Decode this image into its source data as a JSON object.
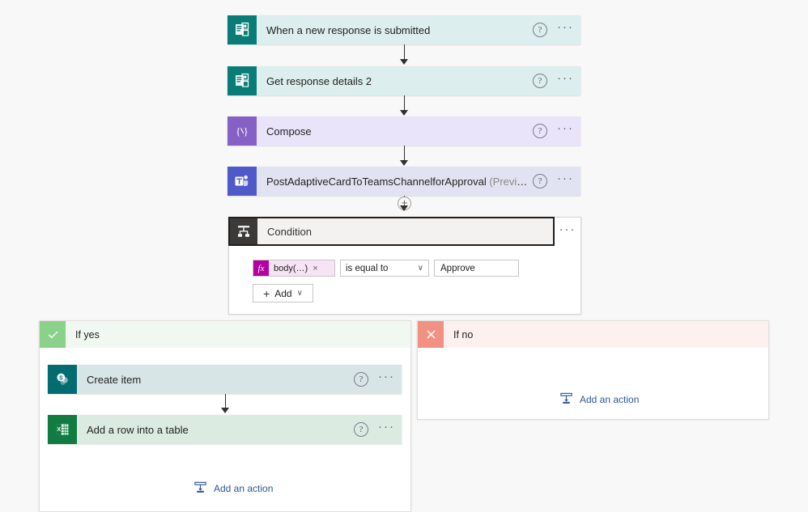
{
  "app": {
    "title": "Power Automate flow designer canvas",
    "canvas_bg": "#f8f8f8"
  },
  "flow": {
    "steps": [
      {
        "id": "trigger-forms",
        "title": "When a new response is submitted",
        "preview": "",
        "icon": "microsoft-forms-icon",
        "icon_bg": "#0a7c77",
        "card_bg": "#dceeee",
        "help_label": "?",
        "menu_label": "···"
      },
      {
        "id": "get-response-details",
        "title": "Get response details 2",
        "preview": "",
        "icon": "microsoft-forms-icon",
        "icon_bg": "#0a7c77",
        "card_bg": "#dceeee",
        "help_label": "?",
        "menu_label": "···"
      },
      {
        "id": "compose",
        "title": "Compose",
        "preview": "",
        "icon": "compose-braces-icon",
        "icon_bg": "#8661c5",
        "card_bg": "#eae4fb",
        "help_label": "?",
        "menu_label": "···"
      },
      {
        "id": "post-adaptive-card-teams",
        "title": "PostAdaptiveCardToTeamsChannelforApproval",
        "preview": "(Preview)",
        "icon": "microsoft-teams-icon",
        "icon_bg": "#5059c9",
        "card_bg": "#e2e3f2",
        "help_label": "?",
        "menu_label": "···"
      }
    ],
    "insert_node_label": "+"
  },
  "condition": {
    "title": "Condition",
    "icon": "condition-branch-icon",
    "menu_label": "···",
    "row": {
      "fx_label": "fx",
      "token_text": "body(…)",
      "token_remove": "×",
      "operator": "is equal to",
      "operator_chevron": "∨",
      "value": "Approve"
    },
    "add_button": {
      "plus": "+",
      "label": "Add",
      "chevron": "∨"
    }
  },
  "branches": {
    "yes": {
      "label": "If yes",
      "flag_icon": "checkmark-icon",
      "flag_color": "#8ad18a",
      "actions": [
        {
          "id": "create-item",
          "title": "Create item",
          "icon": "sharepoint-icon",
          "icon_bg": "#036c70",
          "card_bg": "#d8e5e6",
          "help_label": "?",
          "menu_label": "···"
        },
        {
          "id": "add-row-into-table",
          "title": "Add a row into a table",
          "icon": "excel-icon",
          "icon_bg": "#107c41",
          "card_bg": "#dcebe2",
          "help_label": "?",
          "menu_label": "···"
        }
      ],
      "add_action_label": "Add an action"
    },
    "no": {
      "label": "If no",
      "flag_icon": "cross-icon",
      "flag_color": "#f19184",
      "actions": [],
      "add_action_label": "Add an action"
    }
  }
}
